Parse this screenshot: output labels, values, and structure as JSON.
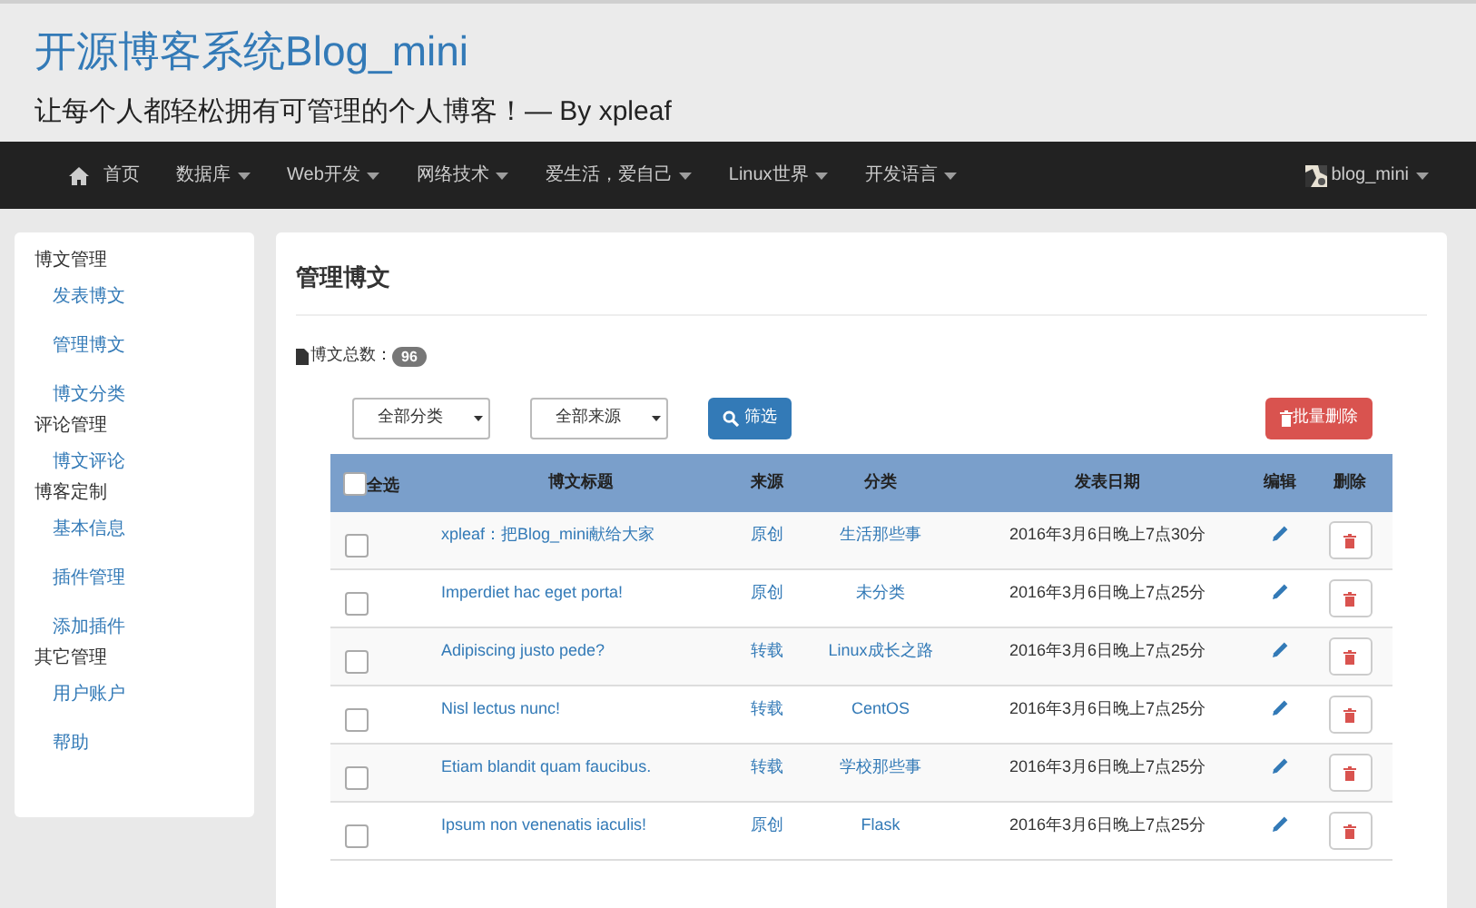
{
  "header": {
    "title": "开源博客系统Blog_mini",
    "subtitle": "让每个人都轻松拥有可管理的个人博客！— By xpleaf"
  },
  "navbar": {
    "items": [
      {
        "label": "首页",
        "kind": "home"
      },
      {
        "label": "数据库",
        "kind": "dropdown"
      },
      {
        "label": "Web开发",
        "kind": "dropdown"
      },
      {
        "label": "网络技术",
        "kind": "dropdown"
      },
      {
        "label": "爱生活，爱自己",
        "kind": "dropdown"
      },
      {
        "label": "Linux世界",
        "kind": "dropdown"
      },
      {
        "label": "开发语言",
        "kind": "dropdown"
      }
    ],
    "user": {
      "label": "blog_mini"
    }
  },
  "sidebar": {
    "groups": [
      {
        "title": "博文管理",
        "items": [
          "发表博文",
          "管理博文",
          "博文分类"
        ]
      },
      {
        "title": "评论管理",
        "items": [
          "博文评论"
        ]
      },
      {
        "title": "博客定制",
        "items": [
          "基本信息",
          "插件管理",
          "添加插件"
        ]
      },
      {
        "title": "其它管理",
        "items": [
          "用户账户",
          "帮助"
        ]
      }
    ]
  },
  "main": {
    "title": "管理博文",
    "count_label": "博文总数：",
    "count": "96",
    "filters": {
      "category": "全部分类",
      "source": "全部来源",
      "filter_button": "筛选",
      "bulk_delete_button": "批量删除"
    },
    "table": {
      "select_all": {
        "label": "全选",
        "checked": false
      },
      "columns": [
        "博文标题",
        "来源",
        "分类",
        "发表日期",
        "编辑",
        "删除"
      ],
      "rows": [
        {
          "checked": false,
          "title": "xpleaf：把Blog_mini献给大家",
          "source": "原创",
          "category": "生活那些事",
          "date": "2016年3月6日晚上7点30分"
        },
        {
          "checked": false,
          "title": "Imperdiet hac eget porta!",
          "source": "原创",
          "category": "未分类",
          "date": "2016年3月6日晚上7点25分"
        },
        {
          "checked": false,
          "title": "Adipiscing justo pede?",
          "source": "转载",
          "category": "Linux成长之路",
          "date": "2016年3月6日晚上7点25分"
        },
        {
          "checked": false,
          "title": "Nisl lectus nunc!",
          "source": "转载",
          "category": "CentOS",
          "date": "2016年3月6日晚上7点25分"
        },
        {
          "checked": false,
          "title": "Etiam blandit quam faucibus.",
          "source": "转载",
          "category": "学校那些事",
          "date": "2016年3月6日晚上7点25分"
        },
        {
          "checked": false,
          "title": "Ipsum non venenatis iaculis!",
          "source": "原创",
          "category": "Flask",
          "date": "2016年3月6日晚上7点25分"
        }
      ]
    }
  }
}
